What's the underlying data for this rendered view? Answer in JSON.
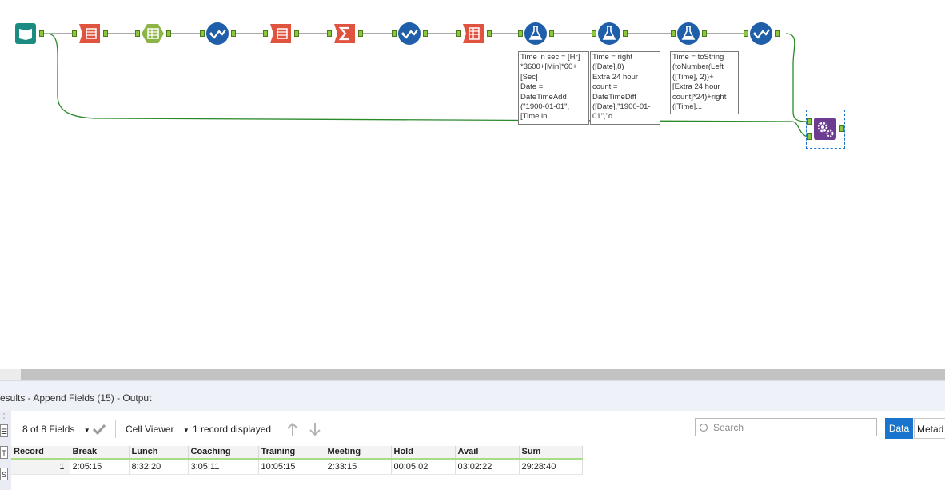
{
  "workflow": {
    "tools": [
      {
        "name": "input-data-tool",
        "icon": "book-icon",
        "color": "#1c8c82"
      },
      {
        "name": "select-tool-1",
        "icon": "select-icon",
        "color": "#e0533f"
      },
      {
        "name": "data-cleansing-tool",
        "icon": "cleanse-icon",
        "color": "#8db447"
      },
      {
        "name": "multi-field-formula-tool-1",
        "icon": "check-icon",
        "color": "#1f5ea8"
      },
      {
        "name": "select-tool-2",
        "icon": "select-icon",
        "color": "#e0533f"
      },
      {
        "name": "summarize-tool",
        "icon": "sigma-icon",
        "color": "#e0533f"
      },
      {
        "name": "multi-field-formula-tool-2",
        "icon": "check-icon",
        "color": "#1f5ea8"
      },
      {
        "name": "transpose-tool",
        "icon": "transpose-icon",
        "color": "#e0533f"
      },
      {
        "name": "formula-tool-1",
        "icon": "flask-icon",
        "color": "#1f5ea8"
      },
      {
        "name": "formula-tool-2",
        "icon": "flask-icon",
        "color": "#1f5ea8"
      },
      {
        "name": "formula-tool-3",
        "icon": "flask-icon",
        "color": "#1f5ea8"
      },
      {
        "name": "multi-field-formula-tool-3",
        "icon": "check-icon",
        "color": "#1f5ea8"
      }
    ],
    "append_tool": {
      "name": "append-fields-tool",
      "icon": "gears-icon",
      "color": "#6b3c8f",
      "target_anchor": "T",
      "source_anchor": "S"
    },
    "annotations": [
      "Time in sec = [Hr]\n*3600+[Min]*60+\n[Sec]\nDate =\nDateTimeAdd\n(\"1900-01-01\",\n[Time in ...",
      "Time = right\n([Date],8)\nExtra 24 hour\ncount =\nDateTimeDiff\n([Date],\"1900-01-\n01\",\"d...",
      "Time = toString\n(toNumber(Left\n([Time], 2))+\n[Extra 24 hour\ncount]*24)+right\n([Time]..."
    ],
    "connection_color": "#2a8a2a"
  },
  "results": {
    "title": "esults - Append Fields (15) - Output",
    "left_buttons": [
      "T",
      "S"
    ]
  },
  "toolbar": {
    "fields_label": "8 of 8 Fields",
    "cell_viewer_label": "Cell Viewer",
    "records_label": "1 record displayed",
    "search_placeholder": "Search",
    "data_label": "Data",
    "metadata_label": "Metad"
  },
  "grid": {
    "columns": [
      "Record",
      "Break",
      "Lunch",
      "Coaching",
      "Training",
      "Meeting",
      "Hold",
      "Avail",
      "Sum"
    ],
    "rows": [
      [
        "1",
        "2:05:15",
        "8:32:20",
        "3:05:11",
        "10:05:15",
        "2:33:15",
        "00:05:02",
        "03:02:22",
        "29:28:40"
      ]
    ]
  }
}
